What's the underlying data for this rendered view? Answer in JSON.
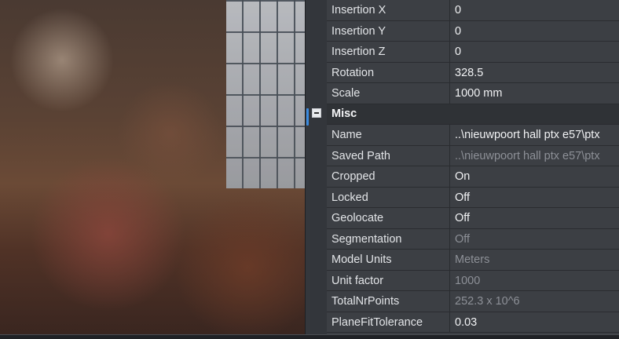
{
  "properties": {
    "rows_top": [
      {
        "label": "Insertion X",
        "value": "0",
        "dim": false
      },
      {
        "label": "Insertion Y",
        "value": "0",
        "dim": false
      },
      {
        "label": "Insertion Z",
        "value": "0",
        "dim": false
      },
      {
        "label": "Rotation",
        "value": "328.5",
        "dim": false
      },
      {
        "label": "Scale",
        "value": "1000 mm",
        "dim": false
      }
    ],
    "section_misc": "Misc",
    "rows_misc": [
      {
        "label": "Name",
        "value": "..\\nieuwpoort hall ptx e57\\ptx",
        "dim": false
      },
      {
        "label": "Saved Path",
        "value": "..\\nieuwpoort hall ptx e57\\ptx",
        "dim": true
      },
      {
        "label": "Cropped",
        "value": "On",
        "dim": false
      },
      {
        "label": "Locked",
        "value": "Off",
        "dim": false
      },
      {
        "label": "Geolocate",
        "value": "Off",
        "dim": false
      },
      {
        "label": "Segmentation",
        "value": "Off",
        "dim": true
      },
      {
        "label": "Model Units",
        "value": "Meters",
        "dim": true
      },
      {
        "label": "Unit factor",
        "value": "1000",
        "dim": true
      },
      {
        "label": "TotalNrPoints",
        "value": "252.3 x 10^6",
        "dim": true
      },
      {
        "label": "PlaneFitTolerance",
        "value": "0.03",
        "dim": false
      }
    ]
  },
  "icons": {
    "collapse": "minus-box-icon"
  },
  "colors": {
    "panel_bg": "#3c3f44",
    "accent": "#3b8be0",
    "dim_text": "#8d9097"
  }
}
